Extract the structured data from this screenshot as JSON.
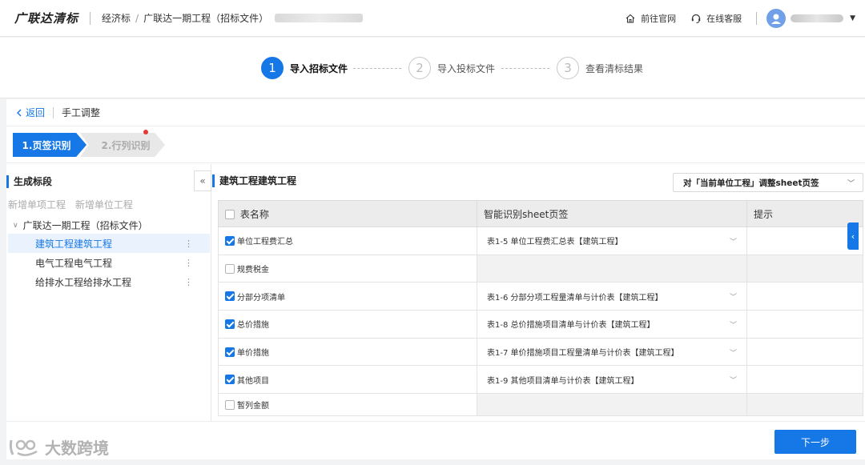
{
  "header": {
    "logo": "广联达清标",
    "breadcrumb": [
      "经济标",
      "广联达一期工程（招标文件）"
    ],
    "links": [
      {
        "label": "前往官网",
        "icon": "home-icon"
      },
      {
        "label": "在线客服",
        "icon": "headset-icon"
      }
    ]
  },
  "steps": [
    {
      "num": "1",
      "label": "导入招标文件",
      "active": true
    },
    {
      "num": "2",
      "label": "导入投标文件",
      "active": false
    },
    {
      "num": "3",
      "label": "查看清标结果",
      "active": false
    }
  ],
  "panel": {
    "back_label": "返回",
    "subtitle": "手工调整",
    "tabs": [
      "1.页签识别",
      "2.行列识别"
    ]
  },
  "left": {
    "title": "生成标段",
    "actions": [
      "新增单项工程",
      "新增单位工程"
    ],
    "root": "广联达一期工程（招标文件）",
    "items": [
      "建筑工程建筑工程",
      "电气工程电气工程",
      "给排水工程给排水工程"
    ]
  },
  "right": {
    "title": "建筑工程建筑工程",
    "adjust_label": "对「当前单位工程」调整sheet页签",
    "columns": [
      "表名称",
      "智能识别sheet页签",
      "提示"
    ],
    "rows": [
      {
        "name": "单位工程费汇总",
        "checked": true,
        "sheet": "表1-5 单位工程费汇总表【建筑工程】"
      },
      {
        "name": "规费税金",
        "checked": false,
        "sheet": ""
      },
      {
        "name": "分部分项清单",
        "checked": true,
        "sheet": "表1-6 分部分项工程量清单与计价表【建筑工程】"
      },
      {
        "name": "总价措施",
        "checked": true,
        "sheet": "表1-8 总价措施项目清单与计价表【建筑工程】"
      },
      {
        "name": "单价措施",
        "checked": true,
        "sheet": "表1-7 单价措施项目工程量清单与计价表【建筑工程】"
      },
      {
        "name": "其他项目",
        "checked": true,
        "sheet": "表1-9 其他项目清单与计价表【建筑工程】"
      },
      {
        "name": "暂列金额",
        "checked": false,
        "sheet": ""
      }
    ]
  },
  "footer": {
    "next_label": "下一步"
  },
  "watermark": "大数跨境",
  "colors": {
    "accent": "#1677e6",
    "alert": "#e53935"
  }
}
